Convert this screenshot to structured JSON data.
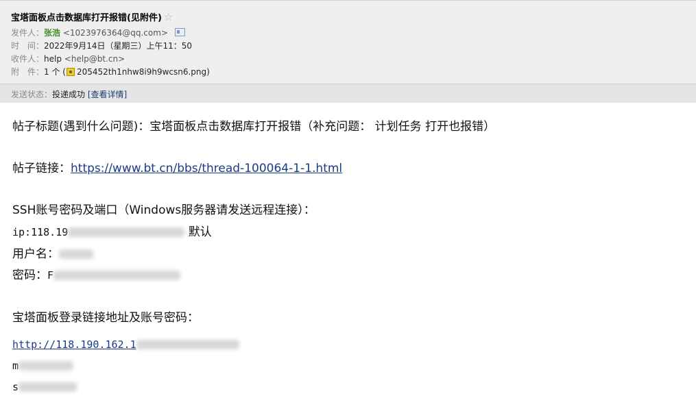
{
  "mail": {
    "subject": "宝塔面板点击数据库打开报错(见附件)",
    "star_icon": "☆",
    "from_label": "发件人：",
    "from_name": "张浩",
    "from_addr": "<1023976364@qq.com>",
    "time_label": "时　间：",
    "time_value": "2022年9月14日（星期三）上午11：50",
    "to_label": "收件人：",
    "to_name": "help",
    "to_addr": "<help@bt.cn>",
    "attach_label": "附　件：",
    "attach_count": "1 个 (",
    "attach_file": "205452th1nhw8i9h9wcsn6.png",
    "attach_close": ")",
    "status_label": "发送状态：",
    "status_value": "投递成功",
    "status_detail": "[查看详情]"
  },
  "content": {
    "title_line": "帖子标题(遇到什么问题)：宝塔面板点击数据库打开报错（补充问题： 计划任务 打开也报错）",
    "link_label": "帖子链接：",
    "link_url": "https://www.bt.cn/bbs/thread-100064-1-1.html",
    "ssh_heading": "SSH账号密码及端口（Windows服务器请发送远程连接）：",
    "ip_prefix": "ip:118.19",
    "port_default": "默认",
    "user_label": "用户名：",
    "pwd_label": "密码：",
    "pwd_first": "F",
    "panel_heading": "宝塔面板登录链接地址及账号密码：",
    "panel_url_prefix": "http://118.190.162.1",
    "panel_user_prefix": "m",
    "panel_pass_prefix": "s"
  },
  "colors": {
    "header_bg": "#efefef",
    "status_bg": "#e5e5e5",
    "sender_green": "#3f8f2a",
    "link_blue": "#1a3a8a"
  },
  "icons": {
    "star": "star-icon",
    "contact_card": "contact-card-icon",
    "attachment": "image-file-icon"
  }
}
